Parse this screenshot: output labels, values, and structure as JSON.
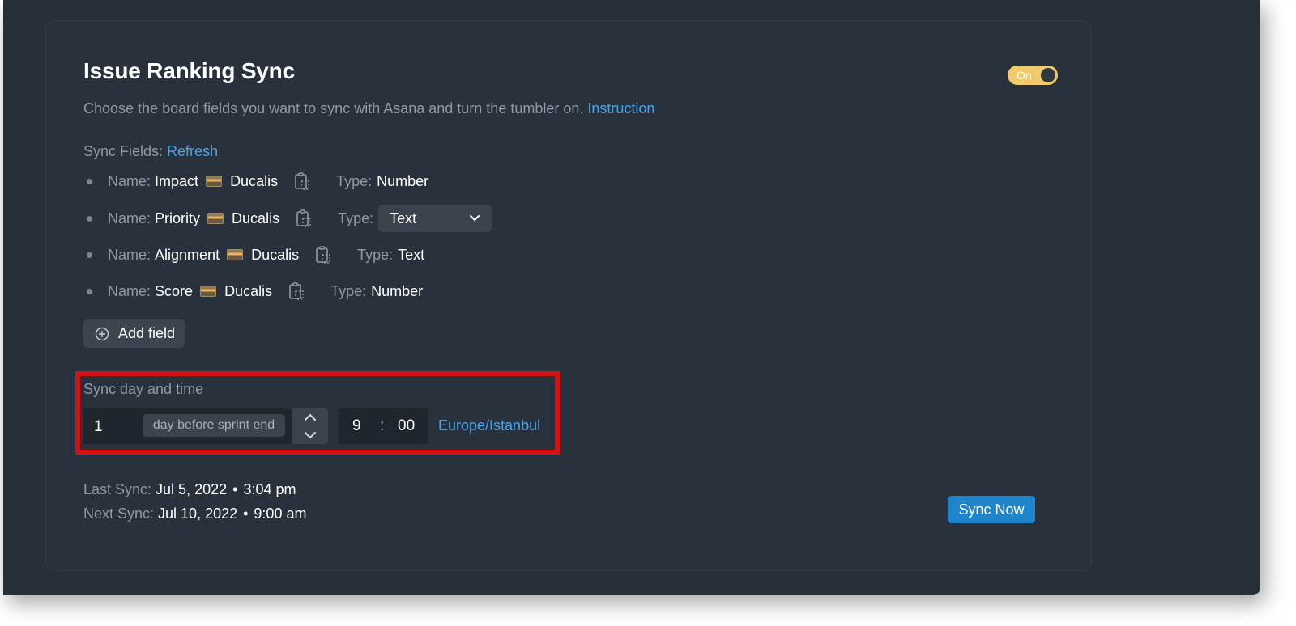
{
  "title": "Issue Ranking Sync",
  "toggle": {
    "label": "On",
    "state": "on",
    "color": "#f2c96b"
  },
  "description": {
    "text": "Choose the board fields you want to sync with Asana and turn the tumbler on. ",
    "link": "Instruction"
  },
  "sync_fields": {
    "label": "Sync Fields: ",
    "refresh": "Refresh",
    "name_label": "Name:",
    "type_label": "Type:",
    "items": [
      {
        "name": "Impact",
        "source": "Ducalis",
        "type": "Number",
        "type_is_select": false
      },
      {
        "name": "Priority",
        "source": "Ducalis",
        "type": "Text",
        "type_is_select": true
      },
      {
        "name": "Alignment",
        "source": "Ducalis",
        "type": "Text",
        "type_is_select": false
      },
      {
        "name": "Score",
        "source": "Ducalis",
        "type": "Number",
        "type_is_select": false
      }
    ]
  },
  "add_field": {
    "label": "Add field",
    "icon": "plus-circle-icon"
  },
  "sync_day_time": {
    "label": "Sync day and time",
    "days_value": "1",
    "unit": "day before sprint end",
    "hour": "9",
    "separator": ":",
    "minute": "00",
    "timezone": "Europe/Istanbul"
  },
  "last_sync": {
    "label": "Last Sync: ",
    "date": "Jul 5, 2022",
    "dot": "•",
    "time": "3:04 pm"
  },
  "next_sync": {
    "label": "Next Sync: ",
    "date": "Jul 10, 2022",
    "dot": "•",
    "time": "9:00 am"
  },
  "sync_now": {
    "label": "Sync Now",
    "color": "#1f84c9"
  },
  "colors": {
    "accent_link": "#4aa3e8",
    "highlight_border": "#d21212",
    "background": "#262e38"
  }
}
